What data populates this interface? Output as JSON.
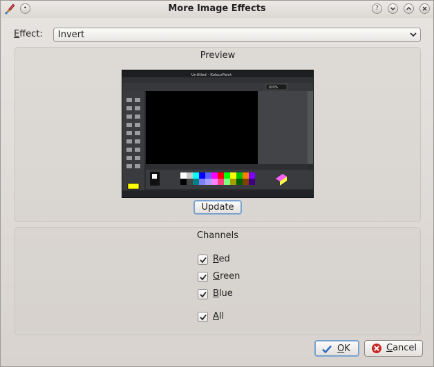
{
  "window": {
    "title": "More Image Effects"
  },
  "effect": {
    "label": "Effect:",
    "mnemonic": "E",
    "rest": "ffect:",
    "value": "Invert"
  },
  "preview": {
    "group_title": "Preview",
    "thumbnail": {
      "title": "Untitled - KolourPaint",
      "zoom": "100%"
    },
    "update_label": "Update"
  },
  "channels": {
    "group_title": "Channels",
    "items": [
      {
        "mn": "R",
        "rest": "ed",
        "checked": true
      },
      {
        "mn": "G",
        "rest": "reen",
        "checked": true
      },
      {
        "mn": "B",
        "rest": "lue",
        "checked": true
      },
      {
        "mn": "A",
        "rest": "ll",
        "checked": true
      }
    ]
  },
  "buttons": {
    "ok_mn": "O",
    "ok_rest": "K",
    "cancel_mn": "C",
    "cancel_rest": "ancel"
  },
  "colors": {
    "accent": "#7aa2cf",
    "ok_icon": "#2f6fbf",
    "cancel_icon": "#c62828"
  }
}
